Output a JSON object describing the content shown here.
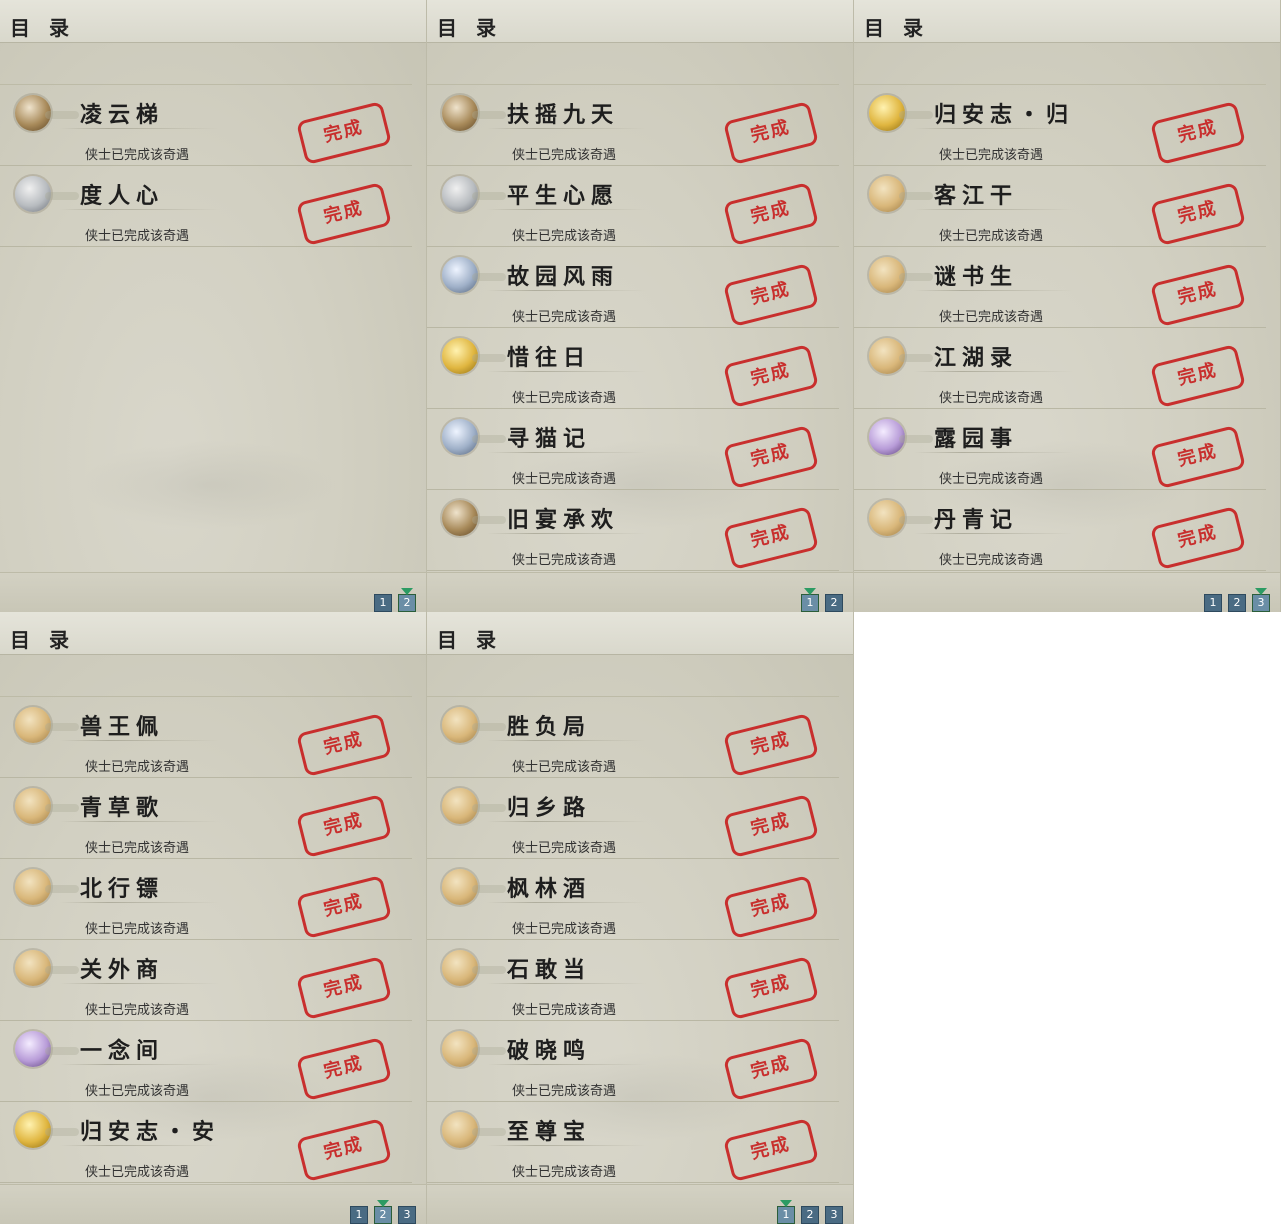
{
  "panels": [
    {
      "header": "目 录",
      "status_text": "侠士已完成该奇遇",
      "stamp_text": "完成",
      "rows": [
        {
          "title": "凌云梯",
          "icon": "monkey-icon"
        },
        {
          "title": "度人心",
          "icon": "mask-icon"
        }
      ],
      "pages": [
        "1",
        "2"
      ],
      "active_page": 1
    },
    {
      "header": "目 录",
      "status_text": "侠士已完成该奇遇",
      "stamp_text": "完成",
      "rows": [
        {
          "title": "扶摇九天",
          "icon": "wooden-pillar-icon"
        },
        {
          "title": "平生心愿",
          "icon": "scholar-icon"
        },
        {
          "title": "故园风雨",
          "icon": "fan-icon"
        },
        {
          "title": "惜往日",
          "icon": "golden-buddha-icon"
        },
        {
          "title": "寻猫记",
          "icon": "gray-cat-icon"
        },
        {
          "title": "旧宴承欢",
          "icon": "thumbs-up-icon"
        }
      ],
      "pages": [
        "1",
        "2"
      ],
      "active_page": 0
    },
    {
      "header": "目 录",
      "status_text": "侠士已完成该奇遇",
      "stamp_text": "完成",
      "rows": [
        {
          "title": "归安志・归",
          "icon": "golden-buddha-icon"
        },
        {
          "title": "客江干",
          "icon": "cat-icon"
        },
        {
          "title": "谜书生",
          "icon": "cat-icon"
        },
        {
          "title": "江湖录",
          "icon": "cat-icon"
        },
        {
          "title": "露园事",
          "icon": "flower-creature-icon"
        },
        {
          "title": "丹青记",
          "icon": "cat-icon"
        }
      ],
      "pages": [
        "1",
        "2",
        "3"
      ],
      "active_page": 2
    },
    {
      "header": "目 录",
      "status_text": "侠士已完成该奇遇",
      "stamp_text": "完成",
      "rows": [
        {
          "title": "兽王佩",
          "icon": "cat-icon"
        },
        {
          "title": "青草歌",
          "icon": "cat-icon"
        },
        {
          "title": "北行镖",
          "icon": "cat-icon"
        },
        {
          "title": "关外商",
          "icon": "cat-icon"
        },
        {
          "title": "一念间",
          "icon": "lady-icon"
        },
        {
          "title": "归安志・安",
          "icon": "golden-buddha-icon"
        }
      ],
      "pages": [
        "1",
        "2",
        "3"
      ],
      "active_page": 1
    },
    {
      "header": "目 录",
      "status_text": "侠士已完成该奇遇",
      "stamp_text": "完成",
      "rows": [
        {
          "title": "胜负局",
          "icon": "cat-icon"
        },
        {
          "title": "归乡路",
          "icon": "cat-icon"
        },
        {
          "title": "枫林酒",
          "icon": "cat-icon"
        },
        {
          "title": "石敢当",
          "icon": "cat-icon"
        },
        {
          "title": "破晓鸣",
          "icon": "cat-icon"
        },
        {
          "title": "至尊宝",
          "icon": "cat-icon"
        }
      ],
      "pages": [
        "1",
        "2",
        "3"
      ],
      "active_page": 0
    }
  ],
  "colors": {
    "stamp_red": "#c81e1e",
    "page_button": "#4a6b83",
    "active_marker": "#2c9b63"
  }
}
